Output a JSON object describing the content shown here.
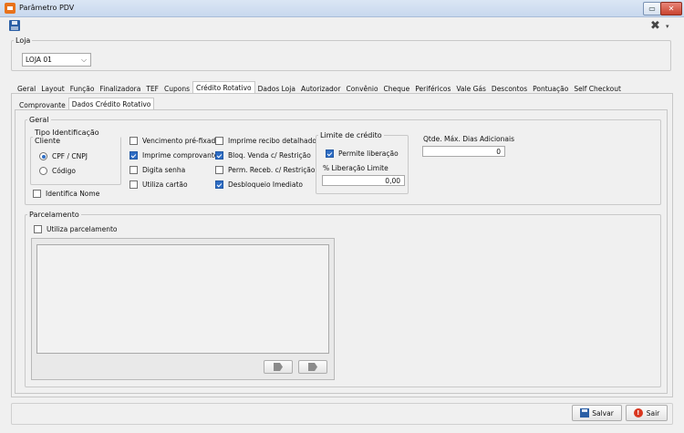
{
  "window": {
    "title": "Parâmetro PDV",
    "restore_glyph": "▭",
    "close_glyph": "✕"
  },
  "toolbar": {
    "tools_glyph": "✖",
    "caret_glyph": "▾"
  },
  "loja": {
    "label": "Loja",
    "value": "LOJA 01",
    "caret": "⌵"
  },
  "tabs": [
    "Geral",
    "Layout",
    "Função",
    "Finalizadora",
    "TEF",
    "Cupons",
    "Crédito Rotativo",
    "Dados Loja",
    "Autorizador",
    "Convênio",
    "Cheque",
    "Periféricos",
    "Vale Gás",
    "Descontos",
    "Pontuação",
    "Self Checkout"
  ],
  "subtabs": [
    "Comprovante",
    "Dados Crédito Rotativo"
  ],
  "geral": {
    "legend": "Geral",
    "tipo_ident": {
      "legend": "Tipo Identificação Cliente",
      "options": [
        "CPF / CNPJ",
        "Código"
      ]
    },
    "identifica_nome": "Identifica Nome",
    "col1": [
      "Vencimento pré-fixado",
      "Imprime comprovante",
      "Digita senha",
      "Utiliza cartão"
    ],
    "col2": [
      "Imprime recibo detalhado",
      "Bloq. Venda c/ Restrição",
      "Perm. Receb. c/ Restrição",
      "Desbloqueio Imediato"
    ],
    "limite": {
      "legend": "Limite de crédito",
      "permite": "Permite liberação",
      "pct_label": "% Liberação Limite",
      "pct_value": "0,00"
    },
    "qtde": {
      "label": "Qtde. Máx. Dias Adicionais",
      "value": "0"
    }
  },
  "parcelamento": {
    "legend": "Parcelamento",
    "utiliza": "Utiliza parcelamento"
  },
  "footer": {
    "save": "Salvar",
    "exit": "Sair",
    "exit_glyph": "!"
  }
}
